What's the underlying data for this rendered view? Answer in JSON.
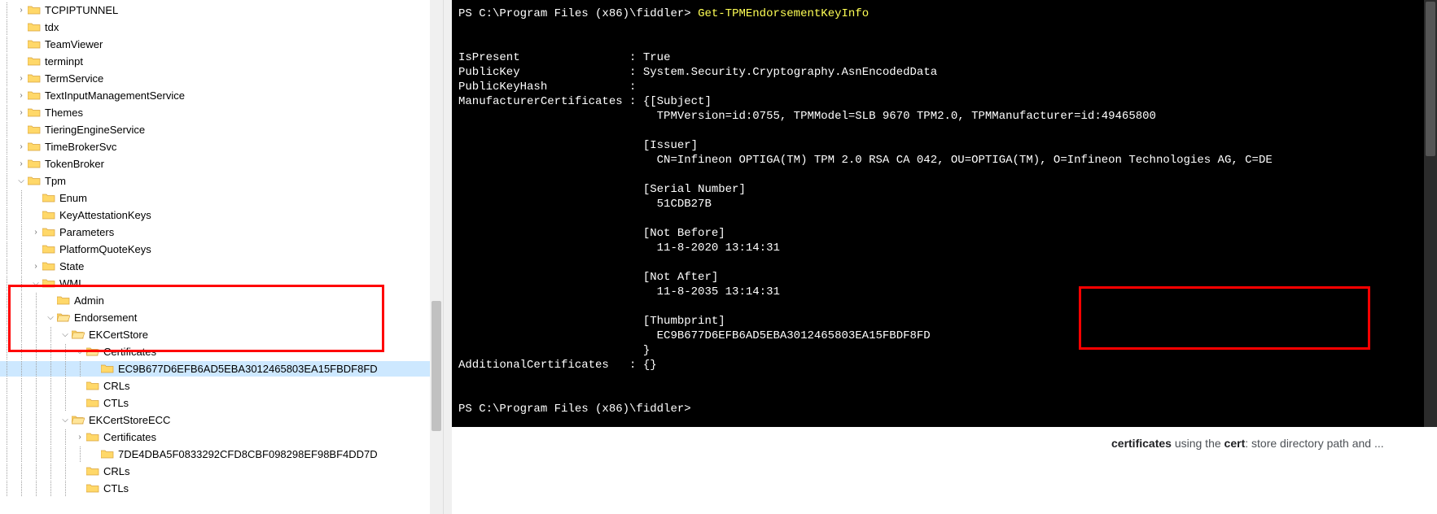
{
  "tree": {
    "items": [
      {
        "depth": 1,
        "exp": "closed",
        "type": "folder",
        "label": "TCPIPTUNNEL"
      },
      {
        "depth": 1,
        "exp": "none",
        "type": "folder",
        "label": "tdx"
      },
      {
        "depth": 1,
        "exp": "none",
        "type": "folder",
        "label": "TeamViewer"
      },
      {
        "depth": 1,
        "exp": "none",
        "type": "folder",
        "label": "terminpt"
      },
      {
        "depth": 1,
        "exp": "closed",
        "type": "folder",
        "label": "TermService"
      },
      {
        "depth": 1,
        "exp": "closed",
        "type": "folder",
        "label": "TextInputManagementService"
      },
      {
        "depth": 1,
        "exp": "closed",
        "type": "folder",
        "label": "Themes"
      },
      {
        "depth": 1,
        "exp": "none",
        "type": "folder",
        "label": "TieringEngineService"
      },
      {
        "depth": 1,
        "exp": "closed",
        "type": "folder",
        "label": "TimeBrokerSvc"
      },
      {
        "depth": 1,
        "exp": "closed",
        "type": "folder",
        "label": "TokenBroker"
      },
      {
        "depth": 1,
        "exp": "open",
        "type": "folder",
        "label": "Tpm"
      },
      {
        "depth": 2,
        "exp": "none",
        "type": "folder",
        "label": "Enum"
      },
      {
        "depth": 2,
        "exp": "none",
        "type": "folder",
        "label": "KeyAttestationKeys"
      },
      {
        "depth": 2,
        "exp": "closed",
        "type": "folder",
        "label": "Parameters"
      },
      {
        "depth": 2,
        "exp": "none",
        "type": "folder",
        "label": "PlatformQuoteKeys"
      },
      {
        "depth": 2,
        "exp": "closed",
        "type": "folder",
        "label": "State"
      },
      {
        "depth": 2,
        "exp": "open",
        "type": "folder",
        "label": "WMI"
      },
      {
        "depth": 3,
        "exp": "none",
        "type": "folder",
        "label": "Admin"
      },
      {
        "depth": 3,
        "exp": "open",
        "type": "folder-open",
        "label": "Endorsement"
      },
      {
        "depth": 4,
        "exp": "open",
        "type": "folder-open",
        "label": "EKCertStore"
      },
      {
        "depth": 5,
        "exp": "open",
        "type": "folder-open",
        "label": "Certificates"
      },
      {
        "depth": 6,
        "exp": "none",
        "type": "folder",
        "label": "EC9B677D6EFB6AD5EBA3012465803EA15FBDF8FD",
        "selected": true
      },
      {
        "depth": 5,
        "exp": "none",
        "type": "folder",
        "label": "CRLs"
      },
      {
        "depth": 5,
        "exp": "none",
        "type": "folder",
        "label": "CTLs"
      },
      {
        "depth": 4,
        "exp": "open",
        "type": "folder-open",
        "label": "EKCertStoreECC"
      },
      {
        "depth": 5,
        "exp": "closed",
        "type": "folder",
        "label": "Certificates"
      },
      {
        "depth": 6,
        "exp": "none",
        "type": "folder",
        "label": "7DE4DBA5F0833292CFD8CBF098298EF98BF4DD7D"
      },
      {
        "depth": 5,
        "exp": "none",
        "type": "folder",
        "label": "CRLs"
      },
      {
        "depth": 5,
        "exp": "none",
        "type": "folder",
        "label": "CTLs"
      }
    ]
  },
  "terminal": {
    "prompt_path": "PS C:\\Program Files (x86)\\fiddler> ",
    "command": "Get-TPMEndorsementKeyInfo",
    "output": {
      "is_present_label": "IsPresent",
      "is_present_value": "True",
      "publickey_label": "PublicKey",
      "publickey_value": "System.Security.Cryptography.AsnEncodedData",
      "publickeyhash_label": "PublicKeyHash",
      "publickeyhash_value": "",
      "mfgcerts_label": "ManufacturerCertificates",
      "subject_hdr": "[Subject]",
      "subject_val": "TPMVersion=id:0755, TPMModel=SLB 9670 TPM2.0, TPMManufacturer=id:49465800",
      "issuer_hdr": "[Issuer]",
      "issuer_val": "CN=Infineon OPTIGA(TM) TPM 2.0 RSA CA 042, OU=OPTIGA(TM), O=Infineon Technologies AG, C=DE",
      "serial_hdr": "[Serial Number]",
      "serial_val": "51CDB27B",
      "notbefore_hdr": "[Not Before]",
      "notbefore_val": "11-8-2020 13:14:31",
      "notafter_hdr": "[Not After]",
      "notafter_val": "11-8-2035 13:14:31",
      "thumb_hdr": "[Thumbprint]",
      "thumb_val": "EC9B677D6EFB6AD5EBA3012465803EA15FBDF8FD",
      "close_brace": "}",
      "addl_label": "AdditionalCertificates",
      "addl_value": "{}"
    },
    "prompt2": "PS C:\\Program Files (x86)\\fiddler>"
  },
  "snippet": {
    "prefix": "certificates",
    "mid": " using the ",
    "bold": "cert",
    "suffix": ": store directory path and ..."
  }
}
